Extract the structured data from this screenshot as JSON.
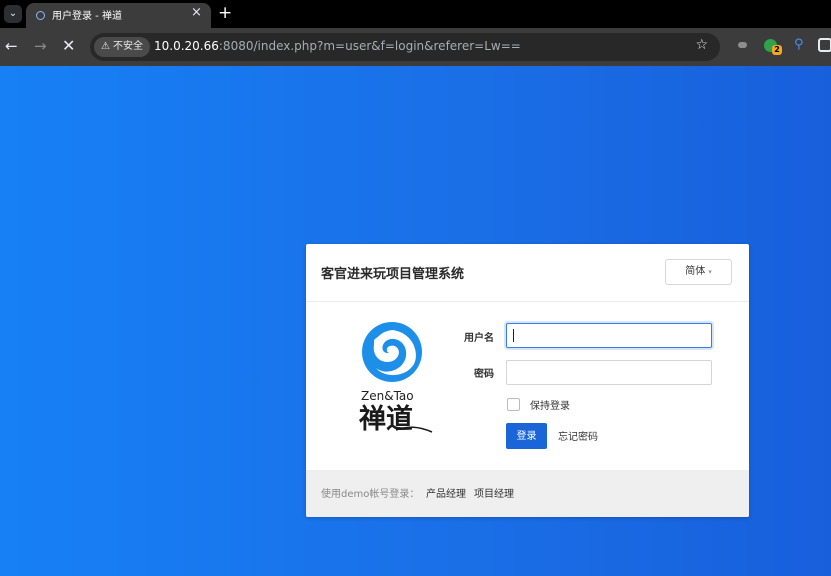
{
  "browser": {
    "tab_switch_glyph": "⌄",
    "tab_title": "用户登录 - 禅道",
    "tab_close": "×",
    "new_tab": "+",
    "nav_back": "←",
    "nav_forward": "→",
    "nav_stop": "✕",
    "security_warning": "⚠",
    "security_label": "不安全",
    "url_host": "10.0.20.66",
    "url_rest": ":8080/index.php?m=user&f=login&referer=Lw==",
    "bookmark_star": "☆",
    "extension_badge": "2",
    "extension_pin": "⚲"
  },
  "login": {
    "title": "客官进来玩项目管理系统",
    "language": "简体",
    "language_caret": "▾",
    "logo_text": "Zen&Tao",
    "logo_chinese": "禅道",
    "username_label": "用户名",
    "username_value": "",
    "password_label": "密码",
    "password_value": "",
    "keep_login_label": "保持登录",
    "login_button": "登录",
    "forgot_password": "忘记密码",
    "demo_prefix": "使用demo帐号登录：",
    "demo_accounts": [
      "产品经理",
      "项目经理"
    ]
  },
  "colors": {
    "background": "#1a6fe7",
    "primary_button": "#1a66d9",
    "logo_blue": "#1e8fe8"
  }
}
